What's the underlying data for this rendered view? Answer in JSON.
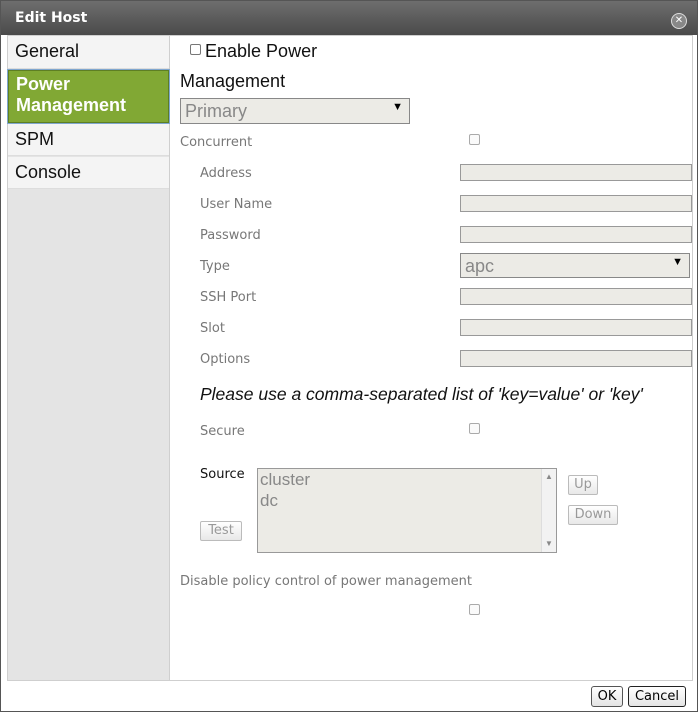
{
  "dialog": {
    "title": "Edit Host",
    "close_icon": "close-icon"
  },
  "sidebar": {
    "items": [
      {
        "label": "General"
      },
      {
        "label": "Power\nManagement",
        "label_line1": "Power",
        "label_line2": "Management",
        "active": true
      },
      {
        "label": "SPM"
      },
      {
        "label": "Console"
      }
    ]
  },
  "form": {
    "enable_power_label": "Enable Power",
    "management_heading": "Management",
    "management_select": {
      "selected": "Primary"
    },
    "concurrent_label": "Concurrent",
    "address_label": "Address",
    "username_label": "User Name",
    "password_label": "Password",
    "type_label": "Type",
    "type_select": {
      "selected": "apc"
    },
    "ssh_port_label": "SSH Port",
    "slot_label": "Slot",
    "options_label": "Options",
    "hint": "Please use a comma-separated list of 'key=value' or 'key'",
    "secure_label": "Secure",
    "source_label": "Source",
    "source_list": [
      "cluster",
      "dc"
    ],
    "up_label": "Up",
    "down_label": "Down",
    "test_label": "Test",
    "disable_policy_label": "Disable policy control of power management"
  },
  "footer": {
    "ok_label": "OK",
    "cancel_label": "Cancel"
  },
  "colors": {
    "accent": "#81a834",
    "titlebar": "#5a5a5a"
  }
}
